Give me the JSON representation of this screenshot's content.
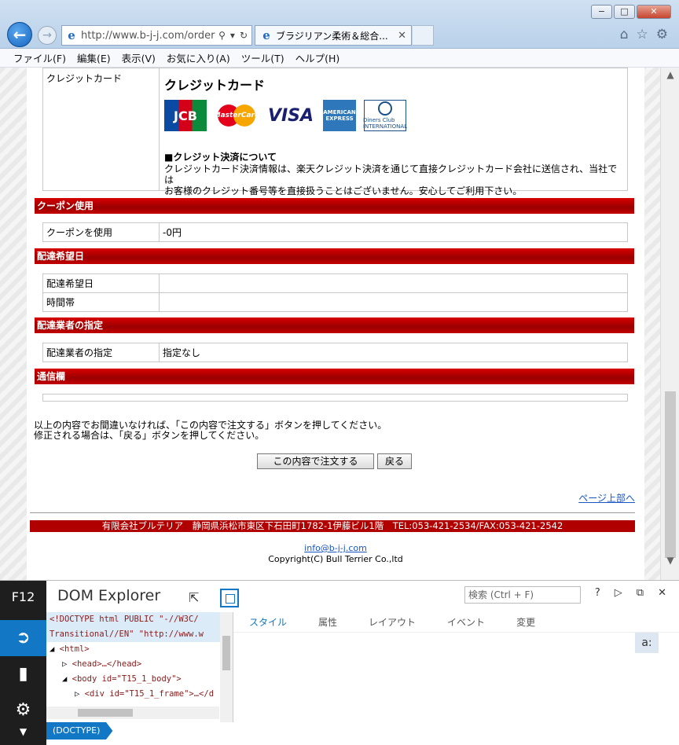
{
  "browser": {
    "url": "http://www.b-j-j.com/order",
    "tab_title": "ブラジリアン柔術＆総合...",
    "window_buttons": [
      "−",
      "□",
      "✕"
    ],
    "icons": [
      "back-icon",
      "forward-icon",
      "search-icon",
      "refresh-icon",
      "home-icon",
      "favorites-icon",
      "settings-icon"
    ]
  },
  "menu": [
    "ファイル(F)",
    "編集(E)",
    "表示(V)",
    "お気に入り(A)",
    "ツール(T)",
    "ヘルプ(H)"
  ],
  "payment": {
    "label": "クレジットカード",
    "title": "クレジットカード",
    "cards": [
      "JCB",
      "MasterCard",
      "VISA",
      "AMERICAN EXPRESS",
      "Diners Club INTERNATIONAL"
    ],
    "note_head": "■クレジット決済について",
    "note_line1": "クレジットカード決済情報は、楽天クレジット決済を通じて直接クレジットカード会社に送信され、当社では",
    "note_line2": "お客様のクレジット番号等を直接扱うことはございません。安心してご利用下さい。"
  },
  "coupon": {
    "section": "クーポン使用",
    "label": "クーポンを使用",
    "value": "-0円"
  },
  "delivery_date": {
    "section": "配達希望日",
    "date_label": "配達希望日",
    "date_value": "",
    "time_label": "時間帯",
    "time_value": ""
  },
  "carrier": {
    "section": "配達業者の指定",
    "label": "配達業者の指定",
    "value": "指定なし"
  },
  "message": {
    "section": "通信欄",
    "value": ""
  },
  "instructions": {
    "line1": "以上の内容でお間違いなければ、「この内容で注文する」ボタンを押してください。",
    "line2": "修正される場合は、「戻る」ボタンを押してください。"
  },
  "buttons": {
    "order": "この内容で注文する",
    "back": "戻る"
  },
  "page_top": "ページ上部へ",
  "footer": {
    "address": "有限会社ブルテリア　静岡県浜松市東区下石田町1782-1伊藤ビル1階　TEL:053-421-2534/FAX:053-421-2542",
    "email": "info@b-j-j.com",
    "copyright": "Copyright(C)  Bull Terrier Co.,ltd"
  },
  "devtools": {
    "f12": "F12",
    "title": "DOM Explorer",
    "search_placeholder": "検索 (Ctrl + F)",
    "tabs": [
      "スタイル",
      "属性",
      "レイアウト",
      "イベント",
      "変更"
    ],
    "a_button": "a:",
    "breadcrumb": "(DOCTYPE)",
    "dom_lines": [
      "<!DOCTYPE html PUBLIC \"-//W3C/",
      "Transitional//EN\" \"http://www.w",
      "<html>",
      "<head>…</head>",
      "<body id=\"T15_1_body\">",
      "<div id=\"T15_1_frame\">…</d"
    ]
  }
}
